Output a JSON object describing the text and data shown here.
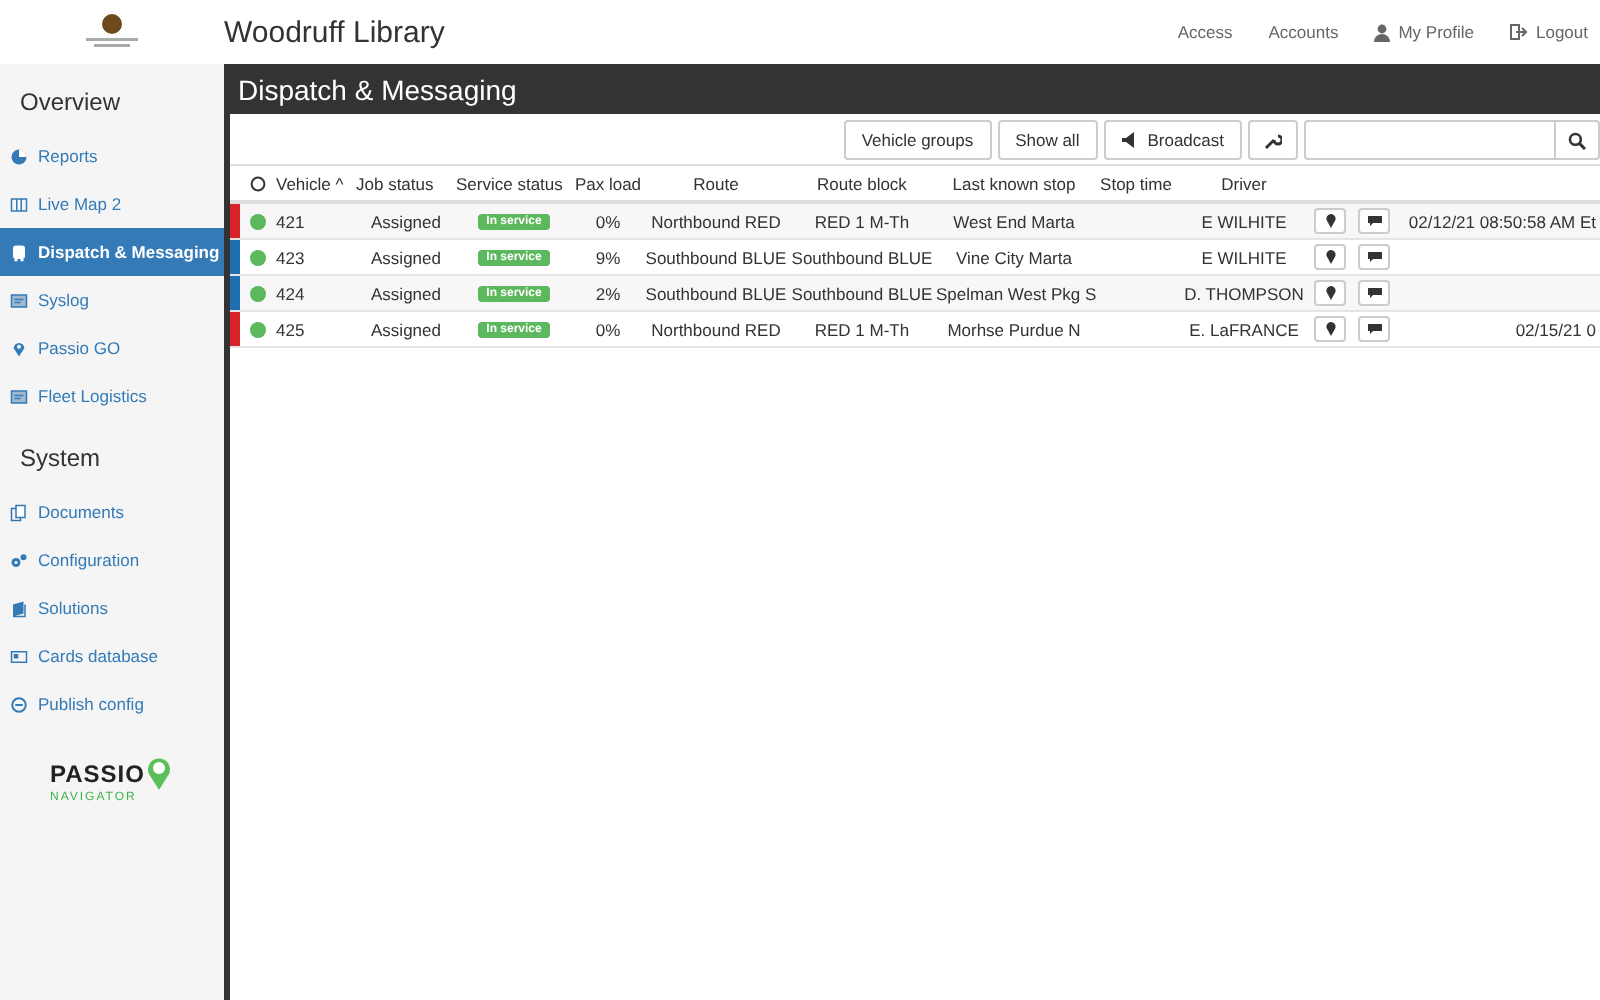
{
  "header": {
    "title": "Woodruff Library",
    "links": [
      {
        "label": "Access",
        "kind": "plain"
      },
      {
        "label": "Accounts",
        "kind": "plain"
      },
      {
        "label": "My Profile",
        "kind": "profile"
      },
      {
        "label": "Logout",
        "kind": "logout"
      }
    ]
  },
  "sidebar": {
    "sections": [
      {
        "title": "Overview",
        "items": [
          {
            "label": "Reports",
            "selected": false
          },
          {
            "label": "Live Map 2",
            "selected": false
          },
          {
            "label": "Dispatch & Messaging",
            "selected": true
          },
          {
            "label": "Syslog",
            "selected": false
          },
          {
            "label": "Passio GO",
            "selected": false
          },
          {
            "label": "Fleet Logistics",
            "selected": false
          }
        ]
      },
      {
        "title": "System",
        "items": [
          {
            "label": "Documents",
            "selected": false
          },
          {
            "label": "Configuration",
            "selected": false
          },
          {
            "label": "Solutions",
            "selected": false
          },
          {
            "label": "Cards database",
            "selected": false
          },
          {
            "label": "Publish config",
            "selected": false
          }
        ]
      }
    ],
    "brand": {
      "name": "PASSIO",
      "tagline": "NAVIGATOR"
    }
  },
  "panel": {
    "title": "Dispatch & Messaging",
    "toolbar": {
      "buttons": [
        "Vehicle groups",
        "Show all",
        "Broadcast"
      ]
    },
    "table": {
      "columns": [
        "Vehicle ^",
        "Job status",
        "Service status",
        "Pax load",
        "Route",
        "Route block",
        "Last known stop",
        "Stop time",
        "Driver"
      ],
      "rows": [
        {
          "color": "#d9232a",
          "vehicle": "421",
          "job": "Assigned",
          "service": "In service",
          "pax": "0%",
          "route": "Northbound RED",
          "block": "RED 1 M-Th",
          "stop": "West End Marta",
          "driver": "E WILHITE",
          "time": "02/12/21 08:50:58 AM Et"
        },
        {
          "color": "#1f6fb2",
          "vehicle": "423",
          "job": "Assigned",
          "service": "In service",
          "pax": "9%",
          "route": "Southbound BLUE",
          "block": "Southbound BLUE",
          "stop": "Vine City Marta",
          "driver": "E WILHITE"
        },
        {
          "color": "#1f6fb2",
          "vehicle": "424",
          "job": "Assigned",
          "service": "In service",
          "pax": "2%",
          "route": "Southbound BLUE",
          "block": "Southbound BLUE",
          "stop": "Spelman West Pkg S",
          "driver": "D. THOMPSON"
        },
        {
          "color": "#d9232a",
          "vehicle": "425",
          "job": "Assigned",
          "service": "In service",
          "pax": "0%",
          "route": "Northbound RED",
          "block": "RED 1 M-Th",
          "stop": "Morhse Purdue N",
          "driver": "E. LaFRANCE",
          "time": "02/15/21 0"
        }
      ]
    }
  }
}
